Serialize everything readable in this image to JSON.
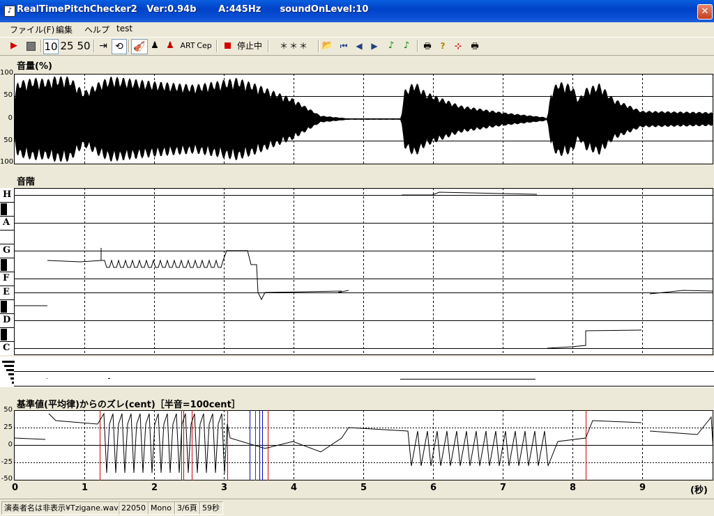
{
  "window": {
    "title": "RealTimePitchChecker2   Ver:0.94b       A:445Hz      soundOnLevel:10",
    "close_glyph": "✕"
  },
  "menu": [
    "ファイル(F)",
    "編集",
    "ヘルプ",
    "test"
  ],
  "toolbar": {
    "play_icon": "play-icon",
    "stop_icon": "stop-icon",
    "zoom_options": [
      "10",
      "25",
      "50"
    ],
    "art_label": "ART",
    "cep_label": "Cep",
    "record_status": "停止中",
    "display_value": "＊＊＊"
  },
  "volume_panel": {
    "title": "音量(%)",
    "axis": [
      "100",
      "50",
      "0",
      "50",
      "100"
    ]
  },
  "scale_panel": {
    "title": "音階",
    "notes": [
      "H",
      "A",
      "G",
      "F",
      "E",
      "D",
      "C"
    ]
  },
  "deviation_panel": {
    "title": "基準値(平均律)からのズレ(cent)［半音=100cent］",
    "axis": [
      "50",
      "25",
      "0",
      "-25",
      "-50"
    ]
  },
  "time_axis": {
    "ticks": [
      "0",
      "1",
      "2",
      "3",
      "4",
      "5",
      "6",
      "7",
      "8",
      "9"
    ],
    "unit": "(秒)"
  },
  "status": {
    "file": "演奏者名は非表示¥Tzigane.wav",
    "rate": "22050",
    "channels": "Mono",
    "page": "3/6頁",
    "duration": "59秒"
  },
  "colors": {
    "red_marker": "#d40000",
    "blue_marker": "#0000c0",
    "titlebar": "#0a4fd6"
  }
}
